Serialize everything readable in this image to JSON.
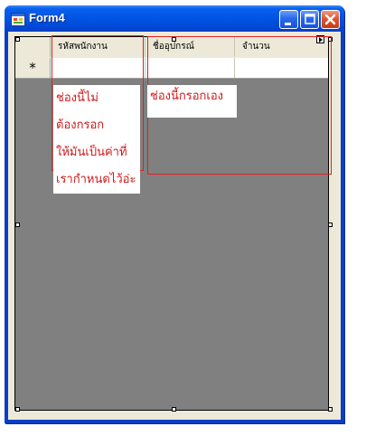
{
  "window": {
    "title": "Form4",
    "icon": "form-app-icon",
    "controls": [
      "minimize-icon",
      "maximize-icon",
      "close-icon"
    ],
    "titlebar_color": "#0054e3",
    "client_color": "#ece9d8"
  },
  "grid": {
    "background_color": "#808080",
    "columns": [
      {
        "header": "รหัสพนักงาน"
      },
      {
        "header": "ชื่ออุปกรณ์"
      },
      {
        "header": "จำนวน"
      }
    ],
    "new_row_marker": "*",
    "smart_tag_icon": "smart-tag-arrow-icon"
  },
  "annotations": {
    "color": "#e02020",
    "note_left_lines": [
      "ช่องนี้ไม่",
      "ต้องกรอก",
      "ให้มันเป็นค่าที่",
      "เรากำหนดไว้อ่ะ"
    ],
    "note_right": "ช่องนี้กรอกเอง"
  }
}
